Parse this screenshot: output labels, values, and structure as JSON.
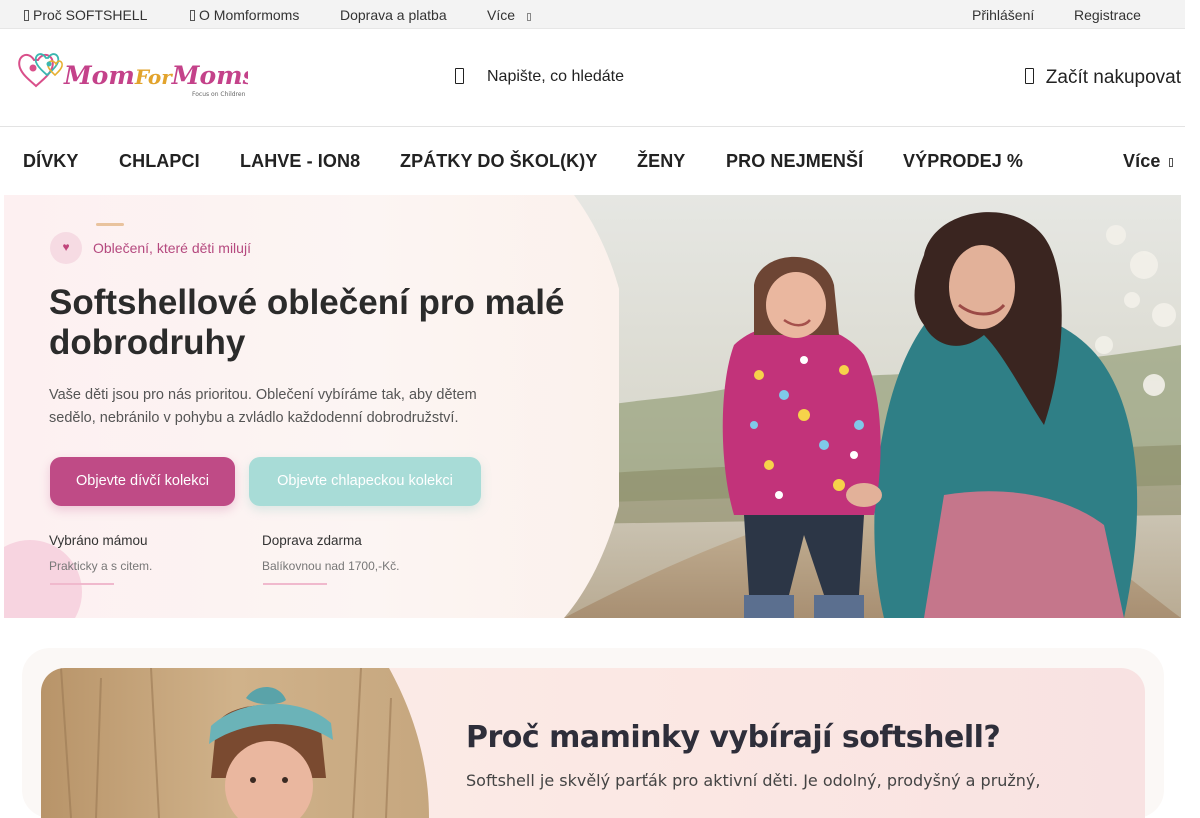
{
  "topbar": {
    "links": [
      "Proč SOFTSHELL",
      "O Momformoms",
      "Doprava a platba",
      "Více"
    ],
    "login": "Přihlášení",
    "register": "Registrace"
  },
  "header": {
    "logo_text": "MomForMoms",
    "logo_tagline": "Focus on Children",
    "search_placeholder": "Napište, co hledáte",
    "cart_label": "Začít nakupovat"
  },
  "nav": {
    "items": [
      "DÍVKY",
      "CHLAPCI",
      "LAHVE - ION8",
      "ZPÁTKY DO ŠKOL(K)Y",
      "ŽENY",
      "PRO NEJMENŠÍ",
      "VÝPRODEJ %"
    ],
    "more": "Více"
  },
  "hero": {
    "tag_icon": "heart-icon",
    "tag": "Oblečení, které děti milují",
    "title": "Softshellové oblečení pro malé dobrodruhy",
    "description": "Vaše děti jsou pro nás prioritou. Oblečení vybíráme tak, aby dětem sedělo, nebránilo v pohybu a zvládlo každodenní dobrodružství.",
    "btn_girls": "Objevte dívčí kolekci",
    "btn_boys": "Objevte chlapeckou kolekci",
    "features": [
      {
        "title": "Vybráno mámou",
        "subtitle": "Prakticky a s citem."
      },
      {
        "title": "Doprava zdarma",
        "subtitle": "Balíkovnou nad 1700,-Kč."
      }
    ]
  },
  "section": {
    "title": "Proč maminky vybírají softshell?",
    "description": "Softshell je skvělý parťák pro aktivní děti. Je odolný, prodyšný a pružný,"
  },
  "colors": {
    "brand_pink": "#bf4b86",
    "brand_mint": "#a8dcd7",
    "accent_gold": "#e9c39e"
  }
}
